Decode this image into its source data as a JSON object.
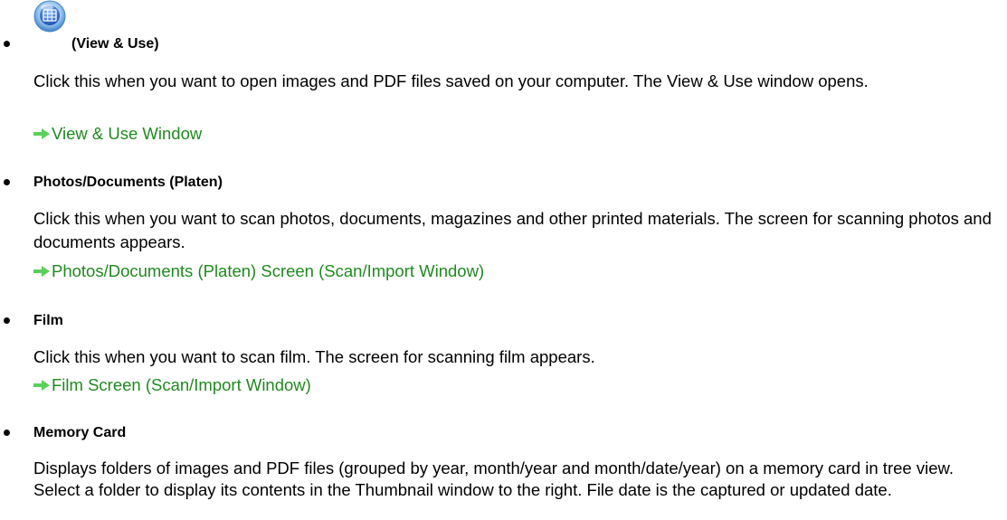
{
  "items": [
    {
      "title": "(View & Use)",
      "icon": "view-use-app-icon",
      "description": "Click this when you want to open images and PDF files saved on your computer. The View & Use window opens.",
      "link": "View & Use Window"
    },
    {
      "title": "Photos/Documents (Platen)",
      "description": "Click this when you want to scan photos, documents, magazines and other printed materials. The screen for scanning photos and documents appears.",
      "link": "Photos/Documents (Platen) Screen (Scan/Import Window)"
    },
    {
      "title": "Film",
      "description": "Click this when you want to scan film. The screen for scanning film appears.",
      "link": "Film Screen (Scan/Import Window)"
    },
    {
      "title": "Memory Card",
      "description": "Displays folders of images and PDF files (grouped by year, month/year and month/date/year) on a memory card in tree view. Select a folder to display its contents in the Thumbnail window to the right. File date is the captured or updated date."
    }
  ],
  "colors": {
    "link": "#1f8a1f",
    "arrow": "#5ad05a",
    "text": "#000000"
  }
}
